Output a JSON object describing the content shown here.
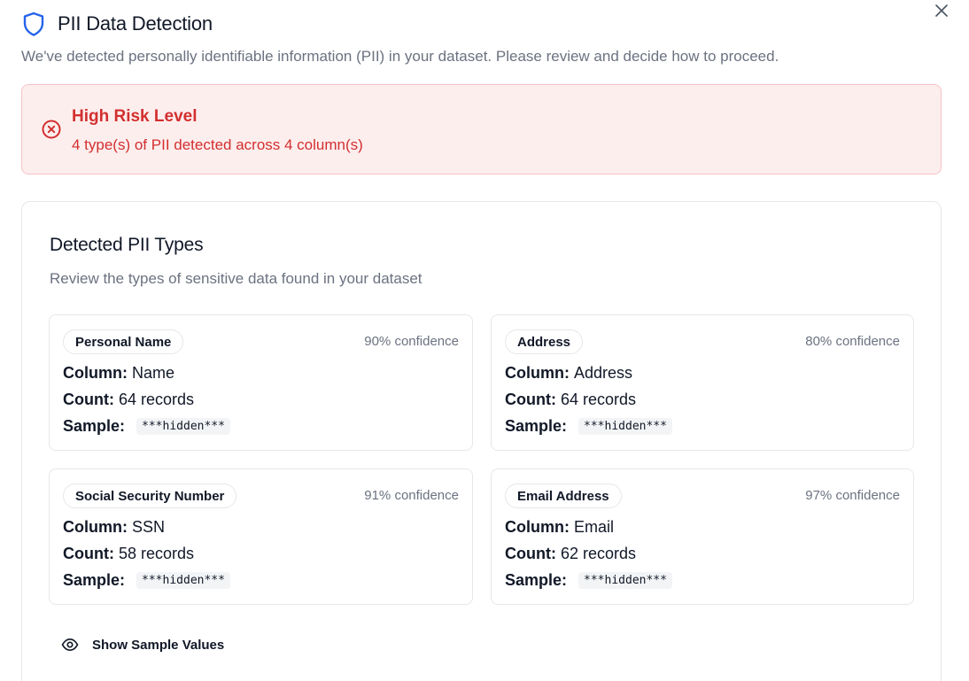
{
  "dialog": {
    "title": "PII Data Detection",
    "subtitle": "We've detected personally identifiable information (PII) in your dataset. Please review and decide how to proceed.",
    "close_icon": "close-icon",
    "header_icon": "shield-icon"
  },
  "alert": {
    "icon": "x-circle-icon",
    "title": "High Risk Level",
    "description": "4 type(s) of PII detected across 4 column(s)",
    "accent_color": "#d32f2f",
    "background_color": "#fdeeee"
  },
  "panel": {
    "title": "Detected PII Types",
    "description": "Review the types of sensitive data found in your dataset",
    "labels": {
      "column": "Column:",
      "count": "Count:",
      "sample": "Sample:"
    },
    "items": [
      {
        "type": "Personal Name",
        "confidence": "90% confidence",
        "column": "Name",
        "count": "64 records",
        "sample": "***hidden***"
      },
      {
        "type": "Address",
        "confidence": "80% confidence",
        "column": "Address",
        "count": "64 records",
        "sample": "***hidden***"
      },
      {
        "type": "Social Security Number",
        "confidence": "91% confidence",
        "column": "SSN",
        "count": "58 records",
        "sample": "***hidden***"
      },
      {
        "type": "Email Address",
        "confidence": "97% confidence",
        "column": "Email",
        "count": "62 records",
        "sample": "***hidden***"
      }
    ],
    "show_samples": {
      "icon": "eye-icon",
      "label": "Show Sample Values"
    }
  },
  "colors": {
    "shield": "#2563eb",
    "muted_text": "#6b7280",
    "border": "#e5e7eb"
  }
}
